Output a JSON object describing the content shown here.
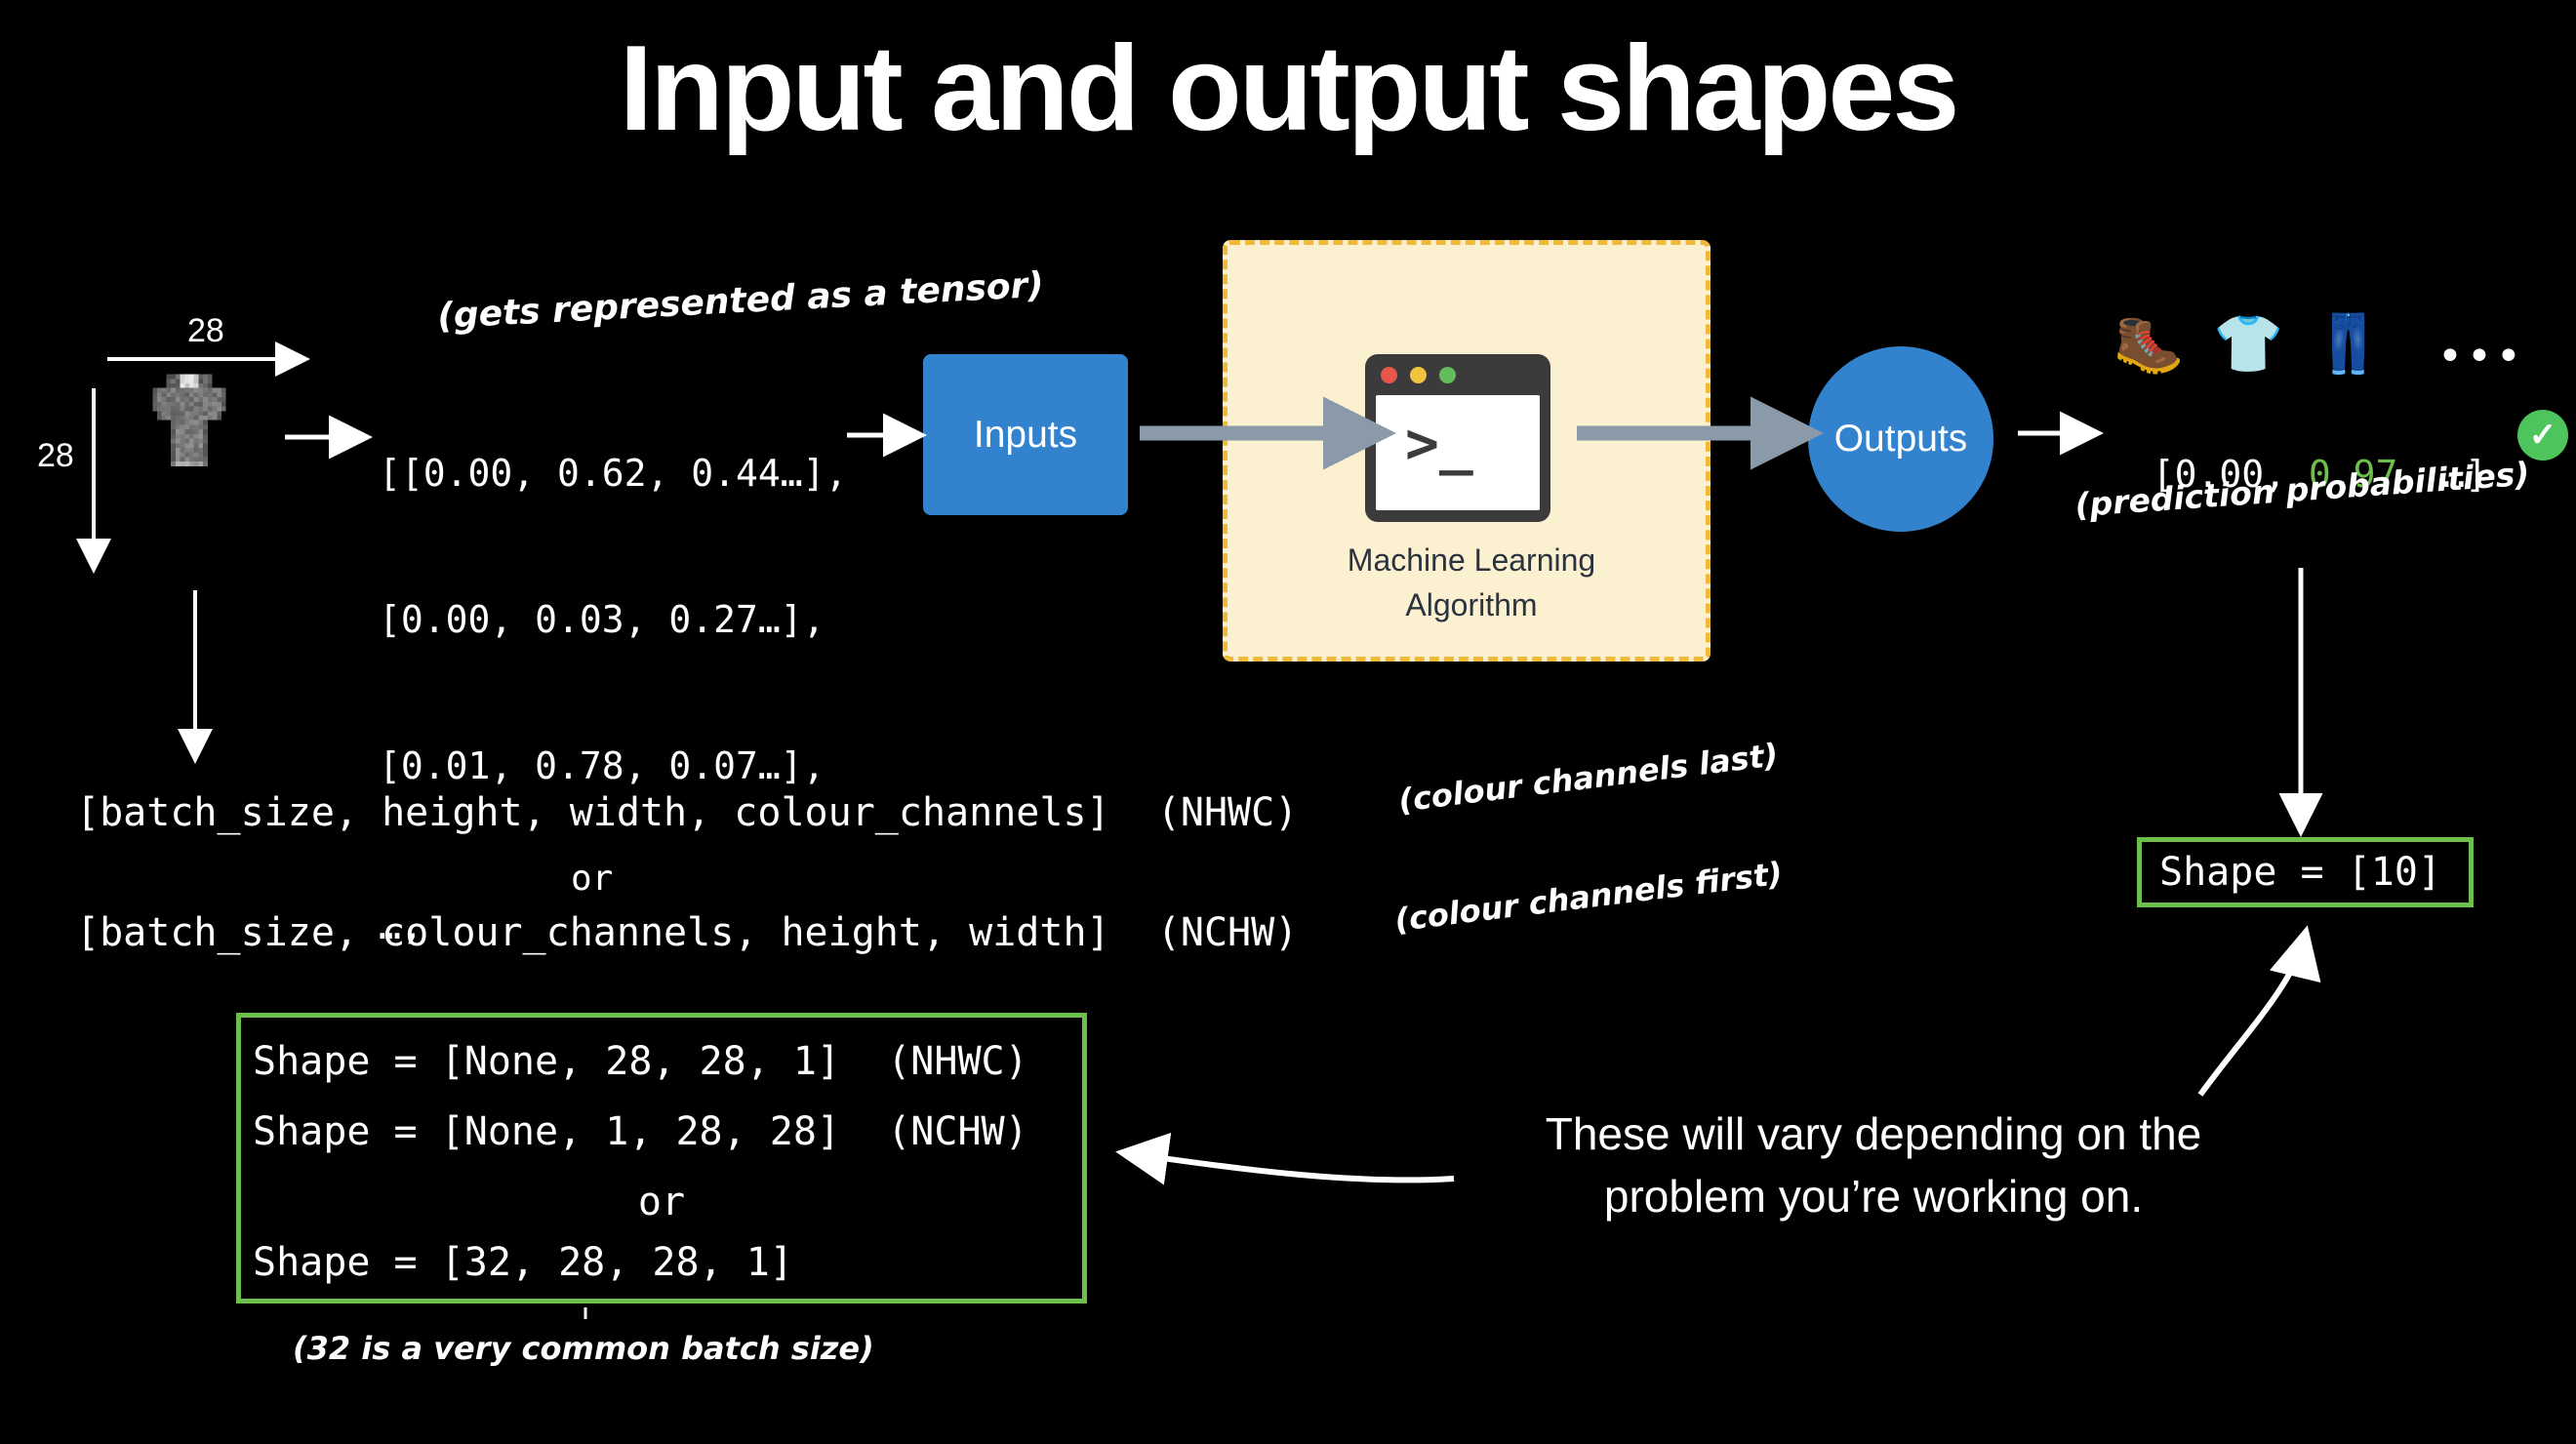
{
  "title": "Input and output shapes",
  "image_panel": {
    "width_label": "28",
    "height_label": "28",
    "image_alt": "fashion-mnist-tshirt-grayscale"
  },
  "annotations": {
    "tensor_note": "(gets represented as a tensor)",
    "prediction_note": "(prediction probabilities)",
    "channels_last": "(colour channels last)",
    "channels_first": "(colour channels first)",
    "batch_size_note": "(32 is a very common batch size)",
    "vary_note": "These will vary depending on the problem you’re working on."
  },
  "tensor": {
    "rows": [
      "[[0.00, 0.62, 0.44…],",
      "[0.00, 0.03, 0.27…],",
      "[0.01, 0.78, 0.07…],",
      "…,"
    ]
  },
  "pipeline": {
    "inputs_label": "Inputs",
    "ml_label_line1": "Machine Learning",
    "ml_label_line2": "Algorithm",
    "outputs_label": "Outputs",
    "terminal_prompt": ">_",
    "traffic_lights": [
      "#e8564a",
      "#f2c43d",
      "#62bd5a"
    ]
  },
  "predictions": {
    "emojis": [
      "🥾",
      "👕",
      "👖"
    ],
    "ellipsis": "•••",
    "vector_prefix": "[0.00, ",
    "vector_highlight": "0.97",
    "vector_suffix": ", …]",
    "check_glyph": "✓"
  },
  "shape_strings": {
    "nhwc": "[batch_size, height, width, colour_channels]  (NHWC)",
    "or": "or",
    "nchw": "[batch_size, colour_channels, height, width]  (NCHW)"
  },
  "shape_box_left": {
    "lines": [
      "Shape = [None, 28, 28, 1]  (NHWC)",
      "Shape = [None, 1, 28, 28]  (NCHW)",
      "or",
      "Shape = [32, 28, 28, 1]"
    ]
  },
  "shape_box_right": {
    "text": "Shape = [10]"
  },
  "colors": {
    "background": "#000000",
    "blue": "#3282cd",
    "yellow_fill": "#fbf0cf",
    "yellow_border": "#f0b93a",
    "green": "#6dbf4b",
    "check_green": "#4dc45c",
    "arrow_gray": "#8a9aa8",
    "dark": "#3b3b3b"
  }
}
